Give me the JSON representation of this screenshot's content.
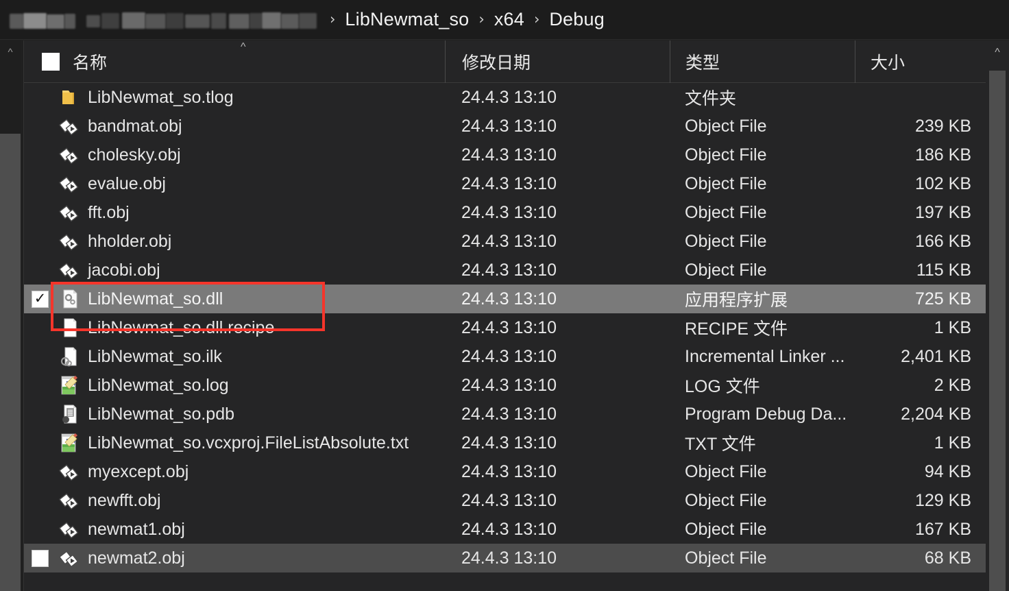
{
  "breadcrumb": {
    "redacted_label": "",
    "separator": "›",
    "items": [
      "LibNewmat_so",
      "x64",
      "Debug"
    ]
  },
  "columns": {
    "name": "名称",
    "date_modified": "修改日期",
    "type": "类型",
    "size": "大小",
    "sort_indicator": "^"
  },
  "scrollbars": {
    "nav_up_arrow": "^",
    "list_up_arrow": "^"
  },
  "checkbox": {
    "checked_glyph": "✓",
    "unchecked_glyph": ""
  },
  "annotation": {
    "color": "#f5352b",
    "target": "LibNewmat_so.dll"
  },
  "colors": {
    "window_background": "#202020",
    "list_background": "#252526",
    "selected_row": "#7a7a7a",
    "hover_row": "#4c4c4c",
    "text": "#e6e6e6",
    "scrollbar_thumb": "#4e4e4e",
    "annotation_red": "#f5352b",
    "folder_yellow": "#f2c14e"
  },
  "files": [
    {
      "name": "LibNewmat_so.tlog",
      "date": "24.4.3 13:10",
      "type": "文件夹",
      "size": "",
      "icon": "folder-icon",
      "state": "normal",
      "checkbox": "none"
    },
    {
      "name": "bandmat.obj",
      "date": "24.4.3 13:10",
      "type": "Object File",
      "size": "239 KB",
      "icon": "object-file-icon",
      "state": "normal",
      "checkbox": "none"
    },
    {
      "name": "cholesky.obj",
      "date": "24.4.3 13:10",
      "type": "Object File",
      "size": "186 KB",
      "icon": "object-file-icon",
      "state": "normal",
      "checkbox": "none"
    },
    {
      "name": "evalue.obj",
      "date": "24.4.3 13:10",
      "type": "Object File",
      "size": "102 KB",
      "icon": "object-file-icon",
      "state": "normal",
      "checkbox": "none"
    },
    {
      "name": "fft.obj",
      "date": "24.4.3 13:10",
      "type": "Object File",
      "size": "197 KB",
      "icon": "object-file-icon",
      "state": "normal",
      "checkbox": "none"
    },
    {
      "name": "hholder.obj",
      "date": "24.4.3 13:10",
      "type": "Object File",
      "size": "166 KB",
      "icon": "object-file-icon",
      "state": "normal",
      "checkbox": "none"
    },
    {
      "name": "jacobi.obj",
      "date": "24.4.3 13:10",
      "type": "Object File",
      "size": "115 KB",
      "icon": "object-file-icon",
      "state": "normal",
      "checkbox": "none"
    },
    {
      "name": "LibNewmat_so.dll",
      "date": "24.4.3 13:10",
      "type": "应用程序扩展",
      "size": "725 KB",
      "icon": "dll-file-icon",
      "state": "selected",
      "checkbox": "checked"
    },
    {
      "name": "LibNewmat_so.dll.recipe",
      "date": "24.4.3 13:10",
      "type": "RECIPE 文件",
      "size": "1 KB",
      "icon": "blank-document-icon",
      "state": "normal",
      "checkbox": "none"
    },
    {
      "name": "LibNewmat_so.ilk",
      "date": "24.4.3 13:10",
      "type": "Incremental Linker ...",
      "size": "2,401 KB",
      "icon": "linker-file-icon",
      "state": "normal",
      "checkbox": "none"
    },
    {
      "name": "LibNewmat_so.log",
      "date": "24.4.3 13:10",
      "type": "LOG 文件",
      "size": "2 KB",
      "icon": "notepad-file-icon",
      "state": "normal",
      "checkbox": "none"
    },
    {
      "name": "LibNewmat_so.pdb",
      "date": "24.4.3 13:10",
      "type": "Program Debug Da...",
      "size": "2,204 KB",
      "icon": "pdb-file-icon",
      "state": "normal",
      "checkbox": "none"
    },
    {
      "name": "LibNewmat_so.vcxproj.FileListAbsolute.txt",
      "date": "24.4.3 13:10",
      "type": "TXT 文件",
      "size": "1 KB",
      "icon": "notepad-file-icon",
      "state": "normal",
      "checkbox": "none"
    },
    {
      "name": "myexcept.obj",
      "date": "24.4.3 13:10",
      "type": "Object File",
      "size": "94 KB",
      "icon": "object-file-icon",
      "state": "normal",
      "checkbox": "none"
    },
    {
      "name": "newfft.obj",
      "date": "24.4.3 13:10",
      "type": "Object File",
      "size": "129 KB",
      "icon": "object-file-icon",
      "state": "normal",
      "checkbox": "none"
    },
    {
      "name": "newmat1.obj",
      "date": "24.4.3 13:10",
      "type": "Object File",
      "size": "167 KB",
      "icon": "object-file-icon",
      "state": "normal",
      "checkbox": "none"
    },
    {
      "name": "newmat2.obj",
      "date": "24.4.3 13:10",
      "type": "Object File",
      "size": "68 KB",
      "icon": "object-file-icon",
      "state": "hover",
      "checkbox": "unchecked"
    }
  ]
}
